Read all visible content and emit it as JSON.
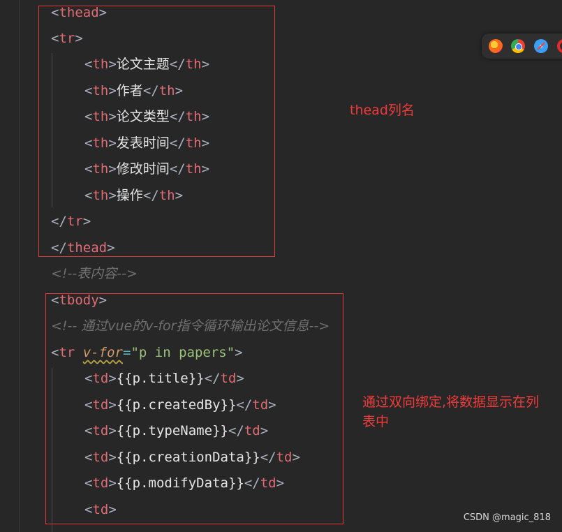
{
  "code": {
    "thead_open": "thead",
    "tr_open": "tr",
    "th_tag": "th",
    "th_cells": [
      "论文主题",
      "作者",
      "论文类型",
      "发表时间",
      "修改时间",
      "操作"
    ],
    "tr_close": "tr",
    "thead_close": "thead",
    "comment_table_content": "<!--表内容-->",
    "tbody_open": "tbody",
    "comment_vfor": "<!-- 通过vue的v-for指令循环输出论文信息-->",
    "vfor_tag": "tr",
    "vfor_attr": "v-for",
    "vfor_value": "\"p in papers\"",
    "td_tag": "td",
    "td_cells": [
      "{{p.title}}",
      "{{p.createdBy}}",
      "{{p.typeName}}",
      "{{p.creationData}}",
      "{{p.modifyData}}"
    ],
    "td_last": "td"
  },
  "annotations": {
    "thead_note": "thead列名",
    "binding_note_line1": "通过双向绑定,将数据显示在列",
    "binding_note_line2": "表中",
    "color": "#f03b3b"
  },
  "browser_icons": [
    "firefox-icon",
    "chrome-icon",
    "safari-icon",
    "opera-icon"
  ],
  "watermark": "CSDN @magic_818"
}
